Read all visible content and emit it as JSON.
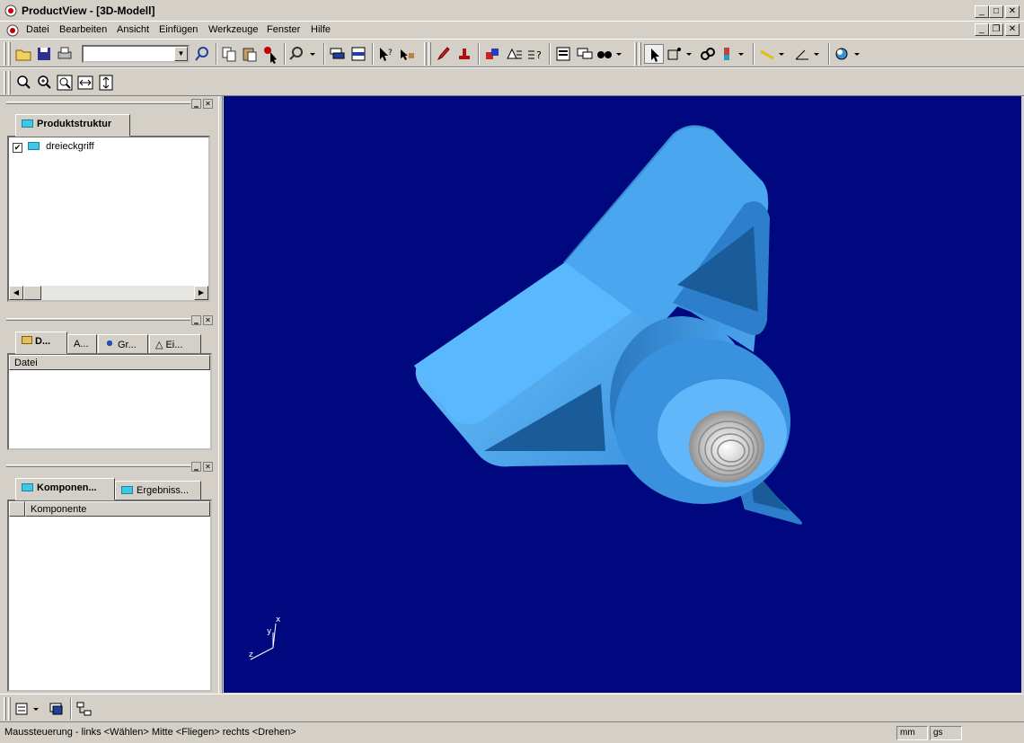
{
  "window": {
    "title": "ProductView - [3D-Modell]"
  },
  "menu": [
    "Datei",
    "Bearbeiten",
    "Ansicht",
    "Einfügen",
    "Werkzeuge",
    "Fenster",
    "Hilfe"
  ],
  "toolbar": {
    "combo_value": ""
  },
  "structure_panel": {
    "tab": "Produktstruktur",
    "tree_item": {
      "label": "dreieckgriff",
      "checked": true
    }
  },
  "docs_panel": {
    "tabs": [
      "D...",
      "A...",
      "Gr...",
      "Ei..."
    ],
    "column": "Datei"
  },
  "components_panel": {
    "tabs": [
      "Komponen...",
      "Ergebniss..."
    ],
    "column": "Komponente"
  },
  "viewport": {
    "background": "#000880",
    "model_color": "#3f96df",
    "axes": {
      "x": "x",
      "y": "y",
      "z": "z"
    }
  },
  "status": {
    "text": "Maussteuerung - links <Wählen> Mitte <Fliegen> rechts <Drehen>",
    "unit": "mm",
    "mass_unit": "gs"
  }
}
